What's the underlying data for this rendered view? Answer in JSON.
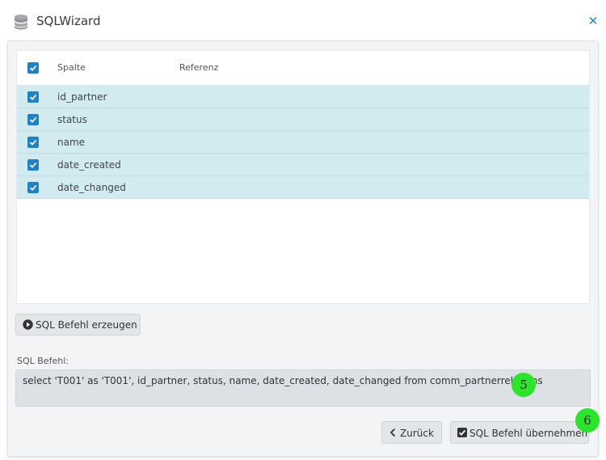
{
  "window": {
    "title": "SQLWizard",
    "icon": "database-icon",
    "close_icon": "close-icon",
    "close_glyph": "✕"
  },
  "grid": {
    "columns": [
      "Spalte",
      "Referenz"
    ],
    "all_checked": true,
    "rows": [
      {
        "spalte": "id_partner",
        "referenz": "",
        "checked": true
      },
      {
        "spalte": "status",
        "referenz": "",
        "checked": true
      },
      {
        "spalte": "name",
        "referenz": "",
        "checked": true
      },
      {
        "spalte": "date_created",
        "referenz": "",
        "checked": true
      },
      {
        "spalte": "date_changed",
        "referenz": "",
        "checked": true
      }
    ]
  },
  "buttons": {
    "generate_label": "SQL Befehl erzeugen",
    "back_label": "Zurück",
    "apply_label": "SQL Befehl übernehmen"
  },
  "sql": {
    "label": "SQL Befehl:",
    "value": "select 'T001' as 'T001', id_partner, status, name, date_created, date_changed from comm_partnerrelations"
  },
  "markers": {
    "m5": "5",
    "m6": "6"
  },
  "colors": {
    "accent": "#1d83c6",
    "row_selected": "#d2ebf1",
    "marker": "#2be52b"
  }
}
